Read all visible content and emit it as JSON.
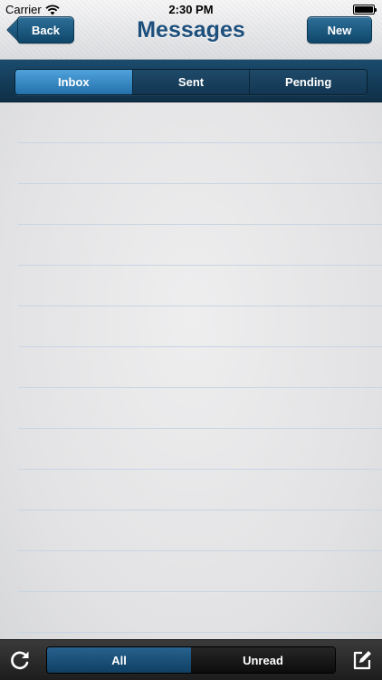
{
  "status_bar": {
    "carrier": "Carrier",
    "time": "2:30 PM",
    "wifi_icon": "wifi-icon",
    "battery_icon": "battery-icon"
  },
  "nav": {
    "title": "Messages",
    "back_label": "Back",
    "new_label": "New"
  },
  "tabs": [
    {
      "label": "Inbox",
      "active": true
    },
    {
      "label": "Sent",
      "active": false
    },
    {
      "label": "Pending",
      "active": false
    }
  ],
  "toolbar": {
    "refresh_icon": "refresh-icon",
    "compose_icon": "compose-icon",
    "filters": [
      {
        "label": "All",
        "active": true
      },
      {
        "label": "Unread",
        "active": false
      }
    ]
  },
  "colors": {
    "title": "#1d4f7c",
    "header_dark": "#133652",
    "tab_active": "#2f86c3",
    "toolbar_active": "#1b5077",
    "rule_line": "#c8d5e3"
  }
}
